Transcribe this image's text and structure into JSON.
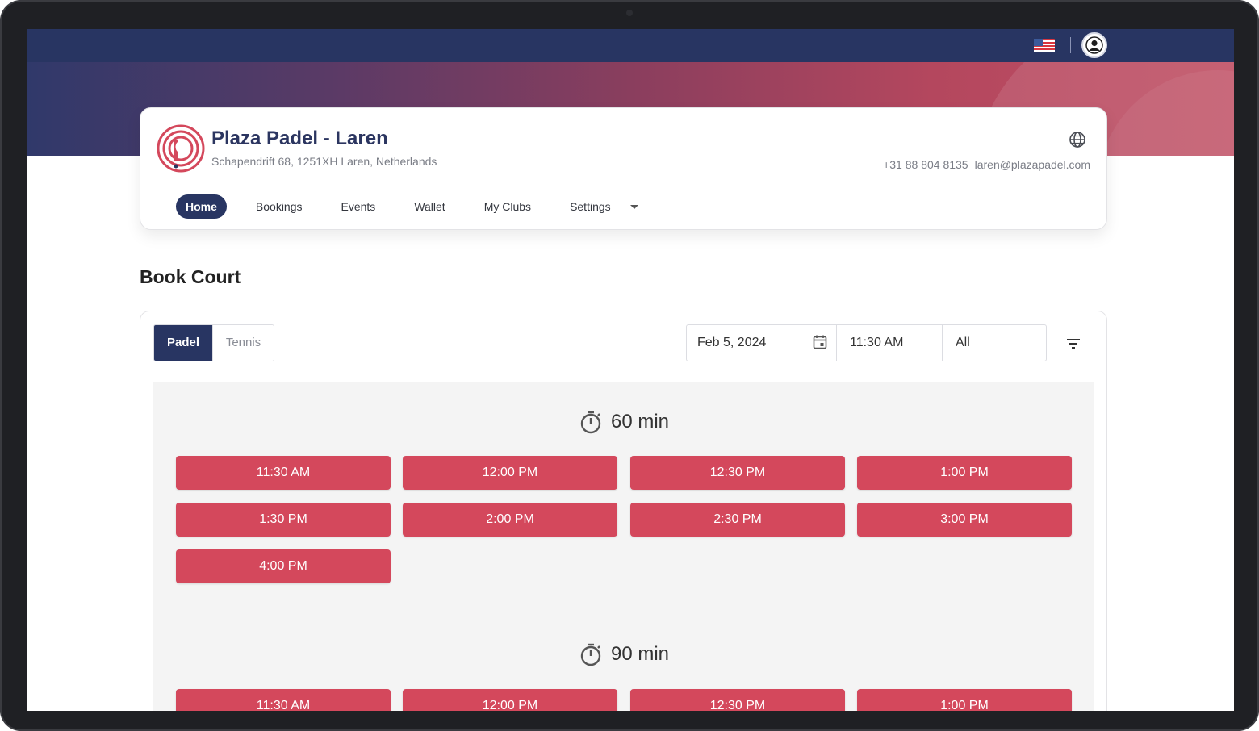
{
  "header": {
    "language_flag": "us-flag-icon",
    "account_icon": "user-avatar-icon"
  },
  "club": {
    "name": "Plaza Padel - Laren",
    "address": "Schapendrift 68, 1251XH Laren, Netherlands",
    "phone": "+31 88 804 8135",
    "email": "laren@plazapadel.com",
    "website_icon": "globe-icon",
    "logo": "plaza-padel-logo"
  },
  "nav": {
    "items": [
      {
        "label": "Home",
        "active": true
      },
      {
        "label": "Bookings",
        "active": false
      },
      {
        "label": "Events",
        "active": false
      },
      {
        "label": "Wallet",
        "active": false
      },
      {
        "label": "My Clubs",
        "active": false
      },
      {
        "label": "Settings",
        "active": false
      }
    ]
  },
  "book_court": {
    "title": "Book Court",
    "sports": [
      {
        "label": "Padel",
        "active": true
      },
      {
        "label": "Tennis",
        "active": false
      }
    ],
    "filters": {
      "date": "Feb 5, 2024",
      "time": "11:30 AM",
      "court": "All"
    },
    "durations": [
      {
        "label": "60 min",
        "slots": [
          "11:30 AM",
          "12:00 PM",
          "12:30 PM",
          "1:00 PM",
          "1:30 PM",
          "2:00 PM",
          "2:30 PM",
          "3:00 PM",
          "4:00 PM"
        ]
      },
      {
        "label": "90 min",
        "slots": [
          "11:30 AM",
          "12:00 PM",
          "12:30 PM",
          "1:00 PM"
        ]
      }
    ]
  },
  "colors": {
    "navy": "#283562",
    "slot_red": "#d4485c",
    "panel_gray": "#f4f4f4"
  }
}
